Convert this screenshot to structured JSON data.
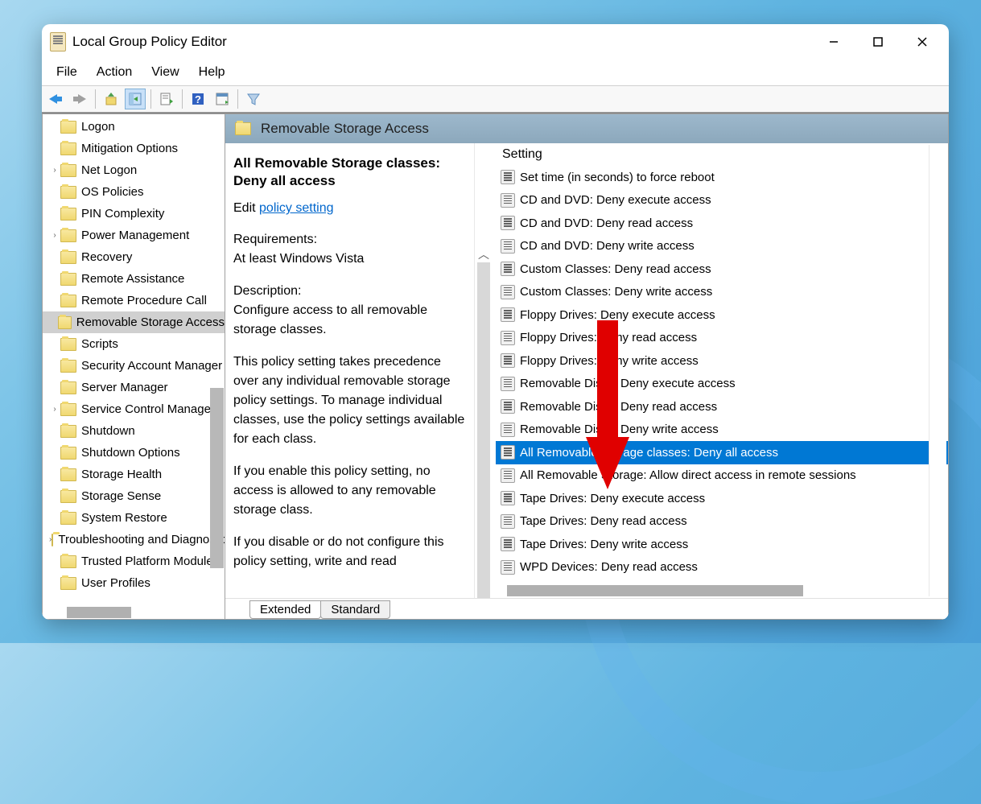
{
  "window": {
    "title": "Local Group Policy Editor"
  },
  "menu": {
    "file": "File",
    "action": "Action",
    "view": "View",
    "help": "Help"
  },
  "tree": {
    "items": [
      {
        "label": "Logon",
        "expand": "none"
      },
      {
        "label": "Mitigation Options",
        "expand": "none"
      },
      {
        "label": "Net Logon",
        "expand": "closed"
      },
      {
        "label": "OS Policies",
        "expand": "none"
      },
      {
        "label": "PIN Complexity",
        "expand": "none"
      },
      {
        "label": "Power Management",
        "expand": "closed"
      },
      {
        "label": "Recovery",
        "expand": "none"
      },
      {
        "label": "Remote Assistance",
        "expand": "none"
      },
      {
        "label": "Remote Procedure Call",
        "expand": "none"
      },
      {
        "label": "Removable Storage Access",
        "expand": "none",
        "selected": true
      },
      {
        "label": "Scripts",
        "expand": "none"
      },
      {
        "label": "Security Account Manager",
        "expand": "none"
      },
      {
        "label": "Server Manager",
        "expand": "none"
      },
      {
        "label": "Service Control Manager",
        "expand": "closed"
      },
      {
        "label": "Shutdown",
        "expand": "none"
      },
      {
        "label": "Shutdown Options",
        "expand": "none"
      },
      {
        "label": "Storage Health",
        "expand": "none"
      },
      {
        "label": "Storage Sense",
        "expand": "none"
      },
      {
        "label": "System Restore",
        "expand": "none"
      },
      {
        "label": "Troubleshooting and Diagnostics",
        "expand": "closed"
      },
      {
        "label": "Trusted Platform Module",
        "expand": "none"
      },
      {
        "label": "User Profiles",
        "expand": "none"
      }
    ]
  },
  "panel": {
    "header": "Removable Storage Access",
    "ext_title": "All Removable Storage classes: Deny all access",
    "edit_label": "Edit ",
    "edit_link": "policy setting",
    "req_label": "Requirements:",
    "req_text": "At least Windows Vista",
    "desc_label": "Description:",
    "desc_1": "Configure access to all removable storage classes.",
    "desc_2": "This policy setting takes precedence over any individual removable storage policy settings. To manage individual classes, use the policy settings available for each class.",
    "desc_3": "If you enable this policy setting, no access is allowed to any removable storage class.",
    "desc_4": "If you disable or do not configure this policy setting, write and read",
    "settings_header": "Setting",
    "settings": [
      {
        "label": "Set time (in seconds) to force reboot"
      },
      {
        "label": "CD and DVD: Deny execute access"
      },
      {
        "label": "CD and DVD: Deny read access"
      },
      {
        "label": "CD and DVD: Deny write access"
      },
      {
        "label": "Custom Classes: Deny read access"
      },
      {
        "label": "Custom Classes: Deny write access"
      },
      {
        "label": "Floppy Drives: Deny execute access"
      },
      {
        "label": "Floppy Drives: Deny read access"
      },
      {
        "label": "Floppy Drives: Deny write access"
      },
      {
        "label": "Removable Disks: Deny execute access"
      },
      {
        "label": "Removable Disks: Deny read access"
      },
      {
        "label": "Removable Disks: Deny write access"
      },
      {
        "label": "All Removable Storage classes: Deny all access",
        "selected": true
      },
      {
        "label": "All Removable Storage: Allow direct access in remote sessions"
      },
      {
        "label": "Tape Drives: Deny execute access"
      },
      {
        "label": "Tape Drives: Deny read access"
      },
      {
        "label": "Tape Drives: Deny write access"
      },
      {
        "label": "WPD Devices: Deny read access"
      }
    ],
    "tab_extended": "Extended",
    "tab_standard": "Standard"
  }
}
